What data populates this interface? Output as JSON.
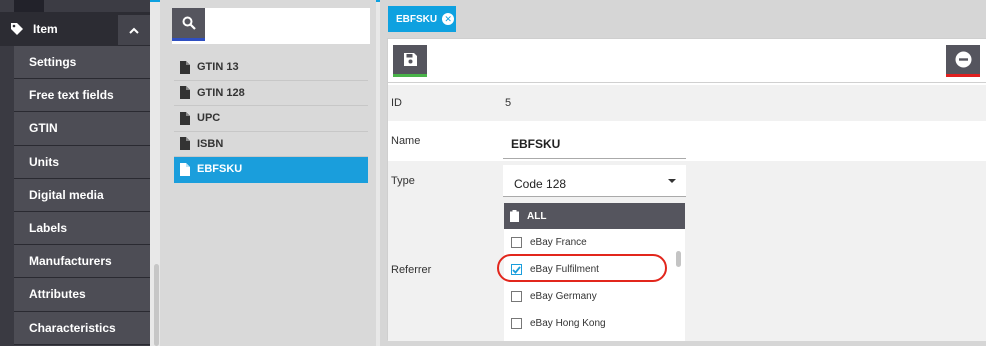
{
  "sidebar": {
    "header_label": "Item",
    "items": [
      {
        "label": "Settings"
      },
      {
        "label": "Free text fields"
      },
      {
        "label": "GTIN"
      },
      {
        "label": "Units"
      },
      {
        "label": "Digital media"
      },
      {
        "label": "Labels"
      },
      {
        "label": "Manufacturers"
      },
      {
        "label": "Attributes"
      },
      {
        "label": "Characteristics"
      }
    ]
  },
  "list": {
    "items": [
      {
        "label": "GTIN 13",
        "active": false
      },
      {
        "label": "GTIN 128",
        "active": false
      },
      {
        "label": "UPC",
        "active": false
      },
      {
        "label": "ISBN",
        "active": false
      },
      {
        "label": "EBFSKU",
        "active": true
      }
    ]
  },
  "tab": {
    "label": "EBFSKU"
  },
  "form": {
    "id_label": "ID",
    "id_value": "5",
    "name_label": "Name",
    "name_value": "EBFSKU",
    "type_label": "Type",
    "type_value": "Code 128",
    "referrer_label": "Referrer",
    "referrer_all": "ALL",
    "referrers": [
      {
        "label": "eBay France",
        "checked": false
      },
      {
        "label": "eBay Fulfilment",
        "checked": true
      },
      {
        "label": "eBay Germany",
        "checked": false
      },
      {
        "label": "eBay Hong Kong",
        "checked": false
      }
    ]
  },
  "colors": {
    "accent": "#0ea1e0",
    "save": "#49b349",
    "delete": "#e02020",
    "highlight": "#e2261c"
  }
}
